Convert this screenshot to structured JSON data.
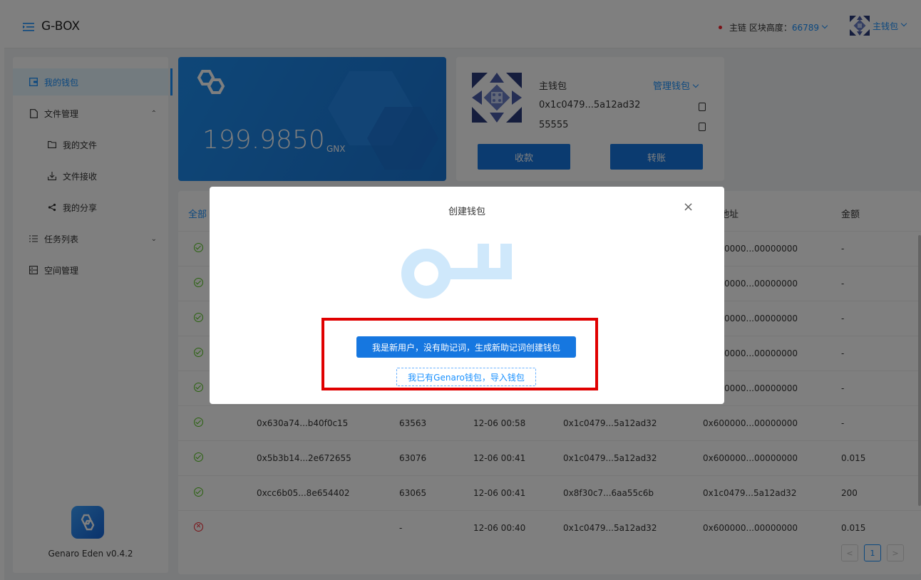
{
  "header": {
    "app_title": "G-BOX",
    "net_label": "主链 区块高度：",
    "block_height": "66789",
    "wallet_name": "主钱包"
  },
  "sidebar": {
    "items": [
      {
        "label": "我的钱包",
        "icon": "wallet-icon"
      },
      {
        "label": "文件管理",
        "icon": "file-icon"
      },
      {
        "label": "我的文件",
        "icon": "folder-icon"
      },
      {
        "label": "文件接收",
        "icon": "download-icon"
      },
      {
        "label": "我的分享",
        "icon": "share-icon"
      },
      {
        "label": "任务列表",
        "icon": "list-icon"
      },
      {
        "label": "空间管理",
        "icon": "storage-icon"
      }
    ],
    "version": "Genaro Eden v0.4.2"
  },
  "balance": {
    "amount": "199.9850",
    "unit": "GNX"
  },
  "wallet": {
    "name": "主钱包",
    "manage_label": "管理钱包",
    "address": "0x1c0479...5a12ad32",
    "number": "55555",
    "receive_label": "收款",
    "transfer_label": "转账"
  },
  "table": {
    "tab_all": "全部",
    "headers": {
      "to_addr": "地址",
      "amount": "金额"
    },
    "rows": [
      {
        "status": "ok",
        "hash": "",
        "block": "",
        "time": "",
        "from": "",
        "to": "0x600000...00000000",
        "amount": "-"
      },
      {
        "status": "ok",
        "hash": "",
        "block": "",
        "time": "",
        "from": "",
        "to": "0x600000...00000000",
        "amount": "-"
      },
      {
        "status": "ok",
        "hash": "",
        "block": "",
        "time": "",
        "from": "",
        "to": "0x600000...00000000",
        "amount": "-"
      },
      {
        "status": "ok",
        "hash": "",
        "block": "",
        "time": "",
        "from": "",
        "to": "0x600000...00000000",
        "amount": "-"
      },
      {
        "status": "ok",
        "hash": "",
        "block": "",
        "time": "",
        "from": "",
        "to": "0x600000...00000000",
        "amount": "-"
      },
      {
        "status": "ok",
        "hash": "0x630a74...b40f0c15",
        "block": "63563",
        "time": "12-06 00:58",
        "from": "0x1c0479...5a12ad32",
        "to": "0x600000...00000000",
        "amount": "-"
      },
      {
        "status": "ok",
        "hash": "0x5b3b14...2e672655",
        "block": "63076",
        "time": "12-06 00:41",
        "from": "0x1c0479...5a12ad32",
        "to": "0x600000...00000000",
        "amount": "0.015"
      },
      {
        "status": "ok",
        "hash": "0xcc6b05...8e654402",
        "block": "63065",
        "time": "12-06 00:41",
        "from": "0x8f30c7...6aa55c6b",
        "to": "0x1c0479...5a12ad32",
        "amount": "200"
      },
      {
        "status": "err",
        "hash": "",
        "block": "-",
        "time": "12-06 00:40",
        "from": "0x1c0479...5a12ad32",
        "to": "0x600000...00000000",
        "amount": "0.015"
      }
    ],
    "pagination": {
      "prev": "<",
      "current": "1",
      "next": ">"
    }
  },
  "modal": {
    "title": "创建钱包",
    "close": "×",
    "primary_label": "我是新用户，没有助记词，生成新助记词创建钱包",
    "secondary_label": "我已有Genaro钱包，导入钱包"
  },
  "colors": {
    "accent": "#1890ff",
    "highlight": "#e00000",
    "success": "#52c41a",
    "error": "#f5222d"
  }
}
